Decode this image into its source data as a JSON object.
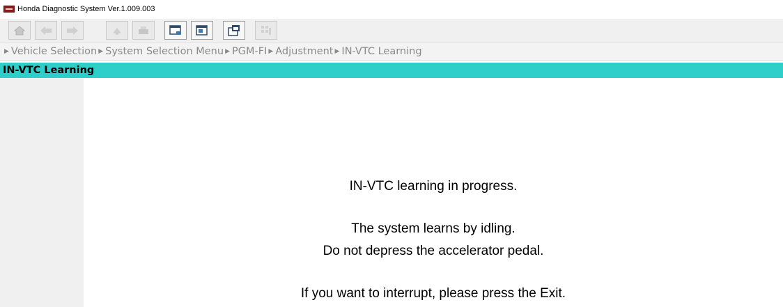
{
  "window": {
    "title": "Honda Diagnostic System Ver.1.009.003",
    "icon": "app-icon"
  },
  "toolbar": {
    "buttons": [
      {
        "name": "home",
        "icon": "home-icon",
        "enabled": false
      },
      {
        "name": "back",
        "icon": "back-arrow-icon",
        "enabled": false
      },
      {
        "name": "forward",
        "icon": "forward-arrow-icon",
        "enabled": false
      },
      {
        "name": "refresh",
        "icon": "refresh-icon",
        "enabled": false
      },
      {
        "name": "print",
        "icon": "printer-icon",
        "enabled": false
      },
      {
        "name": "save-screen",
        "icon": "save-screen-icon",
        "enabled": true
      },
      {
        "name": "window",
        "icon": "window-icon",
        "enabled": true
      },
      {
        "name": "new-window",
        "icon": "new-window-icon",
        "enabled": true
      },
      {
        "name": "settings",
        "icon": "settings-grid-icon",
        "enabled": false
      }
    ]
  },
  "breadcrumb": {
    "items": [
      "Vehicle Selection",
      "System Selection Menu",
      "PGM-FI",
      "Adjustment",
      "IN-VTC Learning"
    ]
  },
  "header": {
    "title": "IN-VTC Learning",
    "color": "#2ecfca"
  },
  "message": {
    "line1": "IN-VTC learning in progress.",
    "line2": "The system learns by idling.",
    "line3": "Do not depress the accelerator pedal.",
    "line4": "If you want to interrupt, please press the Exit."
  }
}
